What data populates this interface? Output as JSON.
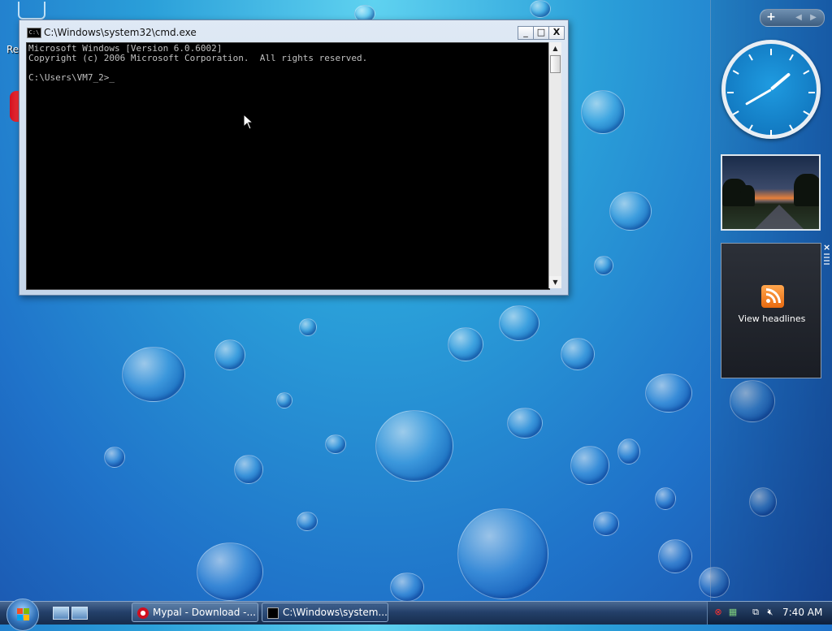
{
  "desktop": {
    "icon_label_partial": "Re"
  },
  "cmd_window": {
    "title": "C:\\Windows\\system32\\cmd.exe",
    "title_icon_text": "C:\\",
    "minimize_glyph": "_",
    "maximize_glyph": "□",
    "close_glyph": "X",
    "console_lines": "Microsoft Windows [Version 6.0.6002]\nCopyright (c) 2006 Microsoft Corporation.  All rights reserved.\n\nC:\\Users\\VM7_2>_"
  },
  "sidebar": {
    "add_glyph": "+",
    "prev_glyph": "◀",
    "next_glyph": "▶",
    "feed_label": "View headlines",
    "feed_close": "×"
  },
  "taskbar": {
    "buttons": [
      {
        "label": "Mypal - Download -...",
        "icon": "mypal-browser-icon"
      },
      {
        "label": "C:\\Windows\\system...",
        "icon": "cmd-icon"
      }
    ],
    "time": "7:40 AM"
  },
  "colors": {
    "console_bg": "#000000",
    "console_fg": "#c0c0c0",
    "taskbar": "#24406a"
  }
}
